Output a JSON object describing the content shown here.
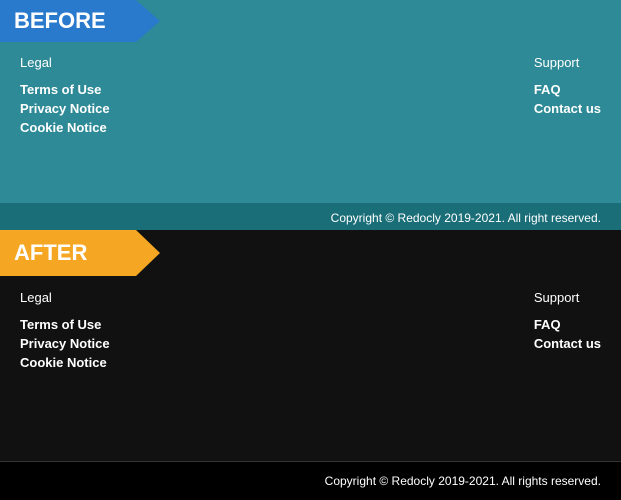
{
  "before": {
    "label": "BEFORE",
    "background": "#2e8a96",
    "legal": {
      "heading": "Legal",
      "links": [
        "Terms of Use",
        "Privacy Notice",
        "Cookie Notice"
      ]
    },
    "support": {
      "heading": "Support",
      "links": [
        "FAQ",
        "Contact us"
      ]
    },
    "copyright": "Copyright © Redocly 2019-2021. All right reserved."
  },
  "after": {
    "label": "AFTER",
    "background": "#111111",
    "legal": {
      "heading": "Legal",
      "links": [
        "Terms of Use",
        "Privacy Notice",
        "Cookie Notice"
      ]
    },
    "support": {
      "heading": "Support",
      "links": [
        "FAQ",
        "Contact us"
      ]
    },
    "copyright": "Copyright © Redocly 2019-2021. All rights reserved."
  }
}
